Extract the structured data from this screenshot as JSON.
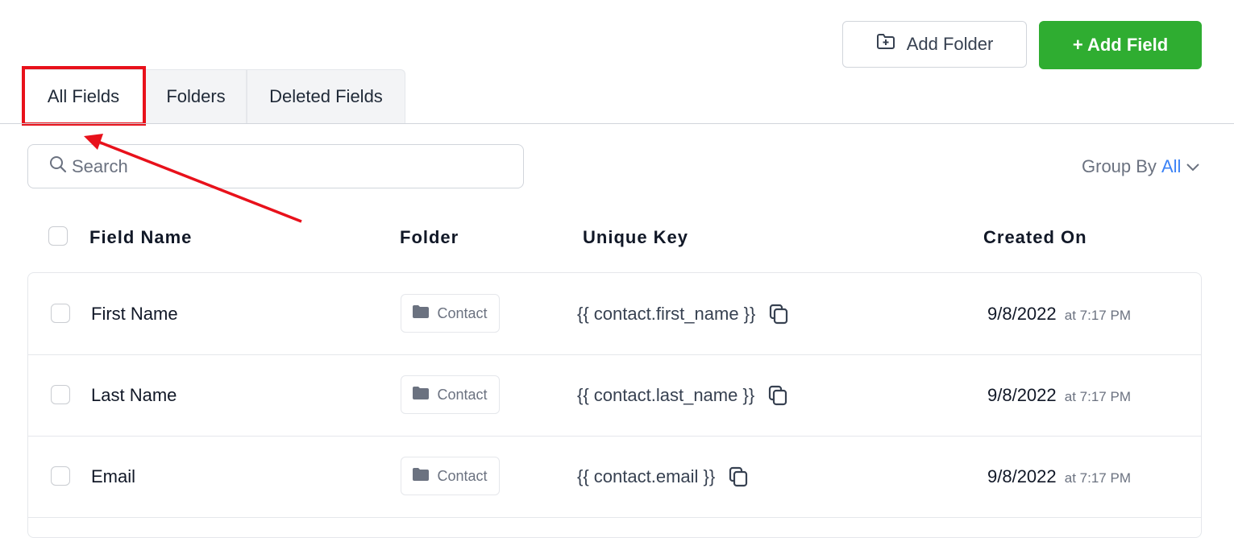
{
  "toolbar": {
    "add_folder_label": "Add Folder",
    "add_field_label": "+ Add Field"
  },
  "tabs": [
    {
      "label": "All Fields",
      "active": true
    },
    {
      "label": "Folders",
      "active": false
    },
    {
      "label": "Deleted Fields",
      "active": false
    }
  ],
  "search": {
    "placeholder": "Search"
  },
  "group_by": {
    "label": "Group By",
    "value": "All"
  },
  "table": {
    "headers": {
      "field_name": "Field Name",
      "folder": "Folder",
      "unique_key": "Unique Key",
      "created_on": "Created On"
    },
    "rows": [
      {
        "name": "First Name",
        "folder": "Contact",
        "key": "{{ contact.first_name }}",
        "date": "9/8/2022",
        "time": "at 7:17 PM"
      },
      {
        "name": "Last Name",
        "folder": "Contact",
        "key": "{{ contact.last_name }}",
        "date": "9/8/2022",
        "time": "at 7:17 PM"
      },
      {
        "name": "Email",
        "folder": "Contact",
        "key": "{{ contact.email }}",
        "date": "9/8/2022",
        "time": "at 7:17 PM"
      }
    ]
  },
  "colors": {
    "accent_green": "#2fad31",
    "highlight_red": "#e8111b",
    "link_blue": "#3b82f6"
  },
  "icons": [
    "folder-plus-icon",
    "search-icon",
    "chevron-down-icon",
    "folder-icon",
    "copy-icon"
  ]
}
